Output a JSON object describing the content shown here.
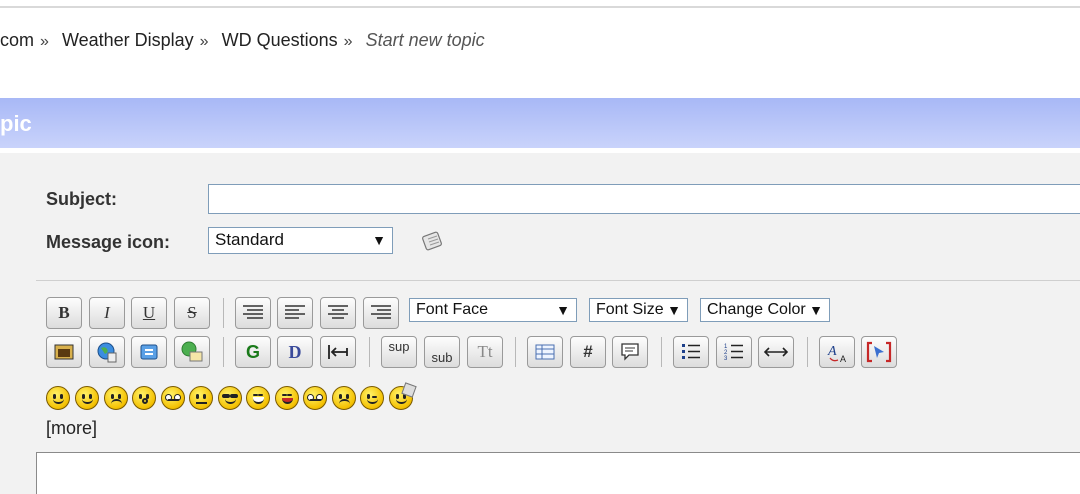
{
  "breadcrumb": {
    "items": [
      "com",
      "Weather Display",
      "WD Questions"
    ],
    "separator": "»",
    "current": "Start new topic"
  },
  "category_bar": {
    "title": "pic"
  },
  "form": {
    "subject_label": "Subject:",
    "subject_value": "",
    "message_icon_label": "Message icon:",
    "message_icon_value": "Standard",
    "more_label": "[more]"
  },
  "toolbar": {
    "font_face": "Font Face",
    "font_size": "Font Size",
    "change_color": "Change Color",
    "bold": "B",
    "italic": "I",
    "underline": "U",
    "strike": "S",
    "glow": "G",
    "shadow": "D",
    "sup": "sup",
    "sub": "sub",
    "teletype": "Tt",
    "code": "#"
  },
  "colors": {
    "category_bar": "#a8b8f6",
    "panel": "#f2f2f2",
    "input_border": "#7f9db9"
  }
}
